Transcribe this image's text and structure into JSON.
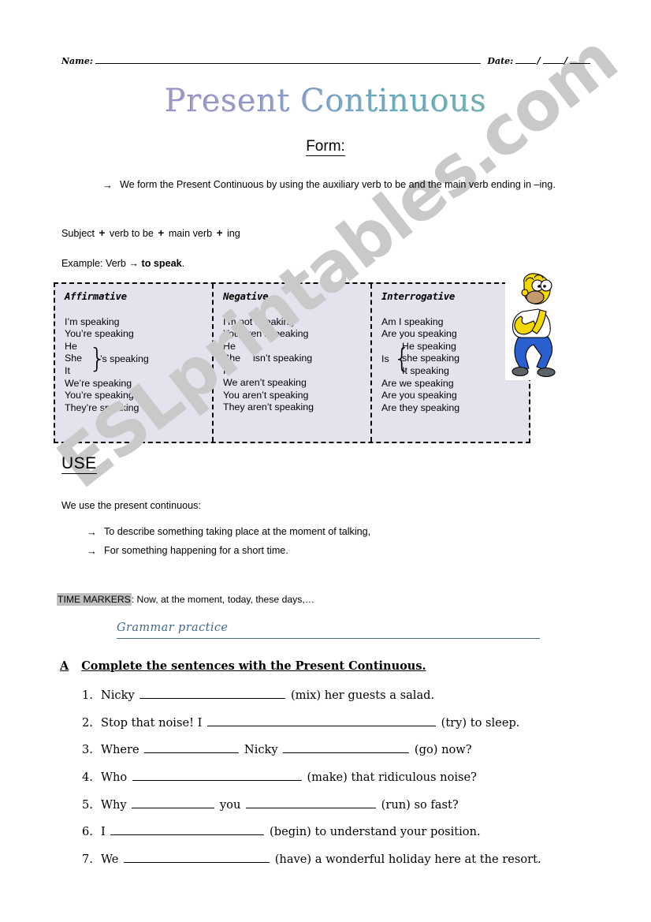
{
  "header": {
    "name_label": "Name:",
    "date_label": "Date:",
    "date_separator": "/"
  },
  "title": "Present Continuous",
  "form": {
    "heading": "Form:",
    "arrow": "→",
    "bullet": "We form the Present Continuous by using the auxiliary verb to be and the main verb ending in –ing.",
    "structure": {
      "subject": "Subject",
      "plus": "+",
      "verb_to_be": "verb to be",
      "main_verb": "main verb",
      "ing": "ing"
    },
    "example_prefix": "Example: Verb",
    "example_arrow": "→",
    "example_verb": "to speak",
    "example_suffix": "."
  },
  "table": {
    "columns": [
      {
        "header": "Affirmative",
        "lines_top": [
          "I’m speaking",
          "You’re speaking"
        ],
        "group": {
          "subjects": [
            "He",
            "She",
            "It"
          ],
          "tail": "’s speaking"
        },
        "lines_bottom": [
          "We’re speaking",
          "You’re speaking",
          "They’re speaking"
        ]
      },
      {
        "header": "Negative",
        "lines_top": [
          "I’m not speaking",
          "You aren’t speaking"
        ],
        "group": {
          "subjects": [
            "He",
            "She",
            "It"
          ],
          "tail": "isn’t speaking"
        },
        "lines_bottom": [
          "We aren’t speaking",
          "You aren’t speaking",
          "They aren’t speaking"
        ]
      },
      {
        "header": "Interrogative",
        "lines_top": [
          "Am I speaking",
          "Are you speaking"
        ],
        "group": {
          "lead": "Is",
          "subjects": [
            "He speaking",
            "she speaking",
            "It speaking"
          ]
        },
        "lines_bottom": [
          "Are we speaking",
          "Are you speaking",
          "Are they speaking"
        ]
      }
    ]
  },
  "use": {
    "heading": "USE",
    "intro": "We use the present continuous:",
    "arrow": "→",
    "bullets": [
      "To describe something taking place at the moment of talking,",
      "For something happening for a short time."
    ],
    "time_markers_label": "TIME MARKERS",
    "time_markers_text": ": Now, at the moment, today, these days,…"
  },
  "grammar_practice": {
    "title": "Grammar practice"
  },
  "exercise": {
    "letter": "A",
    "instruction": "Complete the sentences with the Present Continuous.",
    "items": [
      {
        "num": "1.",
        "before": "Nicky",
        "blank1": 185,
        "middle": "",
        "blank2": 0,
        "after": "(mix) her guests a salad."
      },
      {
        "num": "2.",
        "before": "Stop that noise! I",
        "blank1": 290,
        "middle": "",
        "blank2": 0,
        "after": "(try) to sleep."
      },
      {
        "num": "3.",
        "before": "Where",
        "blank1": 120,
        "middle": "Nicky",
        "blank2": 160,
        "after": "(go) now?"
      },
      {
        "num": "4.",
        "before": "Who",
        "blank1": 215,
        "middle": "",
        "blank2": 0,
        "after": "(make) that ridiculous noise?"
      },
      {
        "num": "5.",
        "before": "Why",
        "blank1": 105,
        "middle": "you",
        "blank2": 165,
        "after": "(run) so fast?"
      },
      {
        "num": "6.",
        "before": "I",
        "blank1": 195,
        "middle": "",
        "blank2": 0,
        "after": "(begin) to understand your position."
      },
      {
        "num": "7.",
        "before": "We",
        "blank1": 185,
        "middle": "",
        "blank2": 0,
        "after": "(have) a wonderful holiday here at the resort."
      }
    ]
  },
  "watermark": {
    "text": "ESLprintables.com"
  },
  "colors": {
    "table_fill": "#e5e2ee",
    "grammar_blue": "#41688c",
    "highlight_grey": "#bfbfbf",
    "watermark_grey": "#c9c9c9"
  },
  "clipart": {
    "name": "homer-simpson-thinking",
    "skin": "#f5d800",
    "shirt": "#ffffff",
    "pants": "#2a5fd0",
    "shoes": "#5d6168",
    "outline": "#000000",
    "mouth": "#c49a6c"
  }
}
